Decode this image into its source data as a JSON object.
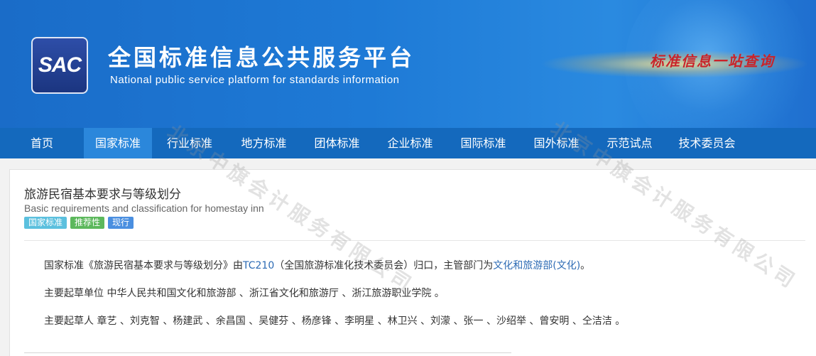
{
  "header": {
    "logo_text": "SAC",
    "title_cn": "全国标准信息公共服务平台",
    "title_en": "National public service platform  for standards information",
    "slogan": "标准信息一站查询"
  },
  "nav": {
    "items": [
      "首页",
      "国家标准",
      "行业标准",
      "地方标准",
      "团体标准",
      "企业标准",
      "国际标准",
      "国外标准",
      "示范试点",
      "技术委员会"
    ],
    "active_index": 1
  },
  "standard": {
    "title_cn": "旅游民宿基本要求与等级划分",
    "title_en": "Basic requirements and classification for homestay inn",
    "badges": [
      "国家标准",
      "推荐性",
      "现行"
    ],
    "line1": {
      "prefix": "国家标准《旅游民宿基本要求与等级划分》由",
      "tc_link": "TC210",
      "middle": "（全国旅游标准化技术委员会）归口，主管部门为",
      "dept_link": "文化和旅游部(文化)",
      "suffix": "。"
    },
    "line2": "主要起草单位 中华人民共和国文化和旅游部 、浙江省文化和旅游厅 、浙江旅游职业学院 。",
    "line3": "主要起草人 章艺 、刘克智 、杨建武 、余昌国 、吴健芬 、杨彦锋 、李明星 、林卫兴 、刘濛 、张一 、沙绍举 、曾安明 、仝洁洁 。"
  },
  "watermark": "北京中旗会计服务有限公司",
  "colors": {
    "banner": "#1e7ad6",
    "nav": "#1469bd",
    "nav_active": "#2b87db",
    "link": "#2d6bb4"
  }
}
